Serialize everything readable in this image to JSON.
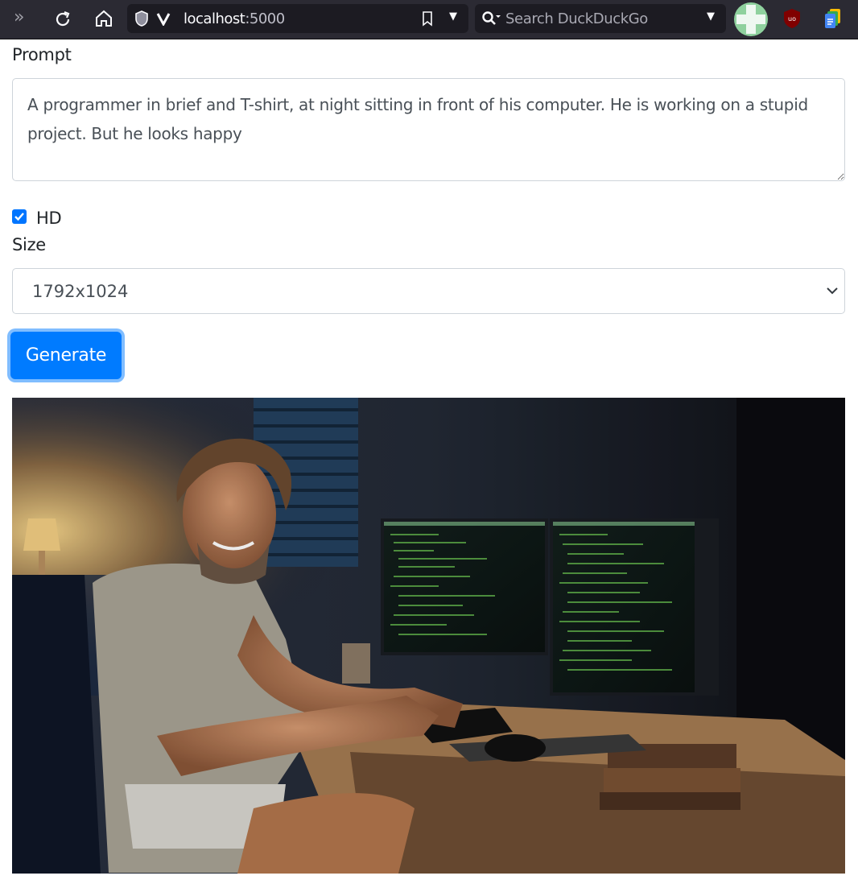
{
  "browser": {
    "url_host": "localhost",
    "url_port": ":5000",
    "search_placeholder": "Search DuckDuckGo",
    "icons": [
      "overflow-chevrons-icon",
      "reload-icon",
      "home-icon",
      "shield-icon",
      "vivaldi-v-icon",
      "bookmark-icon",
      "dropdown-icon",
      "search-icon",
      "profile-avatar-icon",
      "ublock-origin-icon",
      "google-docs-extension-icon"
    ]
  },
  "form": {
    "prompt_label": "Prompt",
    "prompt_value": "A programmer in brief and T-shirt, at night sitting in front of his computer. He is working on a stupid project. But he looks happy",
    "hd_label": "HD",
    "hd_checked": true,
    "size_label": "Size",
    "size_value": "1792x1024",
    "generate_label": "Generate"
  },
  "colors": {
    "primary": "#007bff",
    "toolbar": "#2b2a33"
  }
}
